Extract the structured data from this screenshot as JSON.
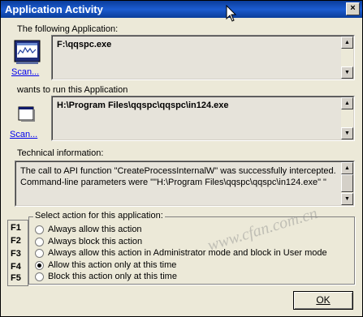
{
  "window": {
    "title": "Application Activity",
    "close_symbol": "×"
  },
  "source_app": {
    "label": "The following Application:",
    "scan_label": "Scan...",
    "path": "F:\\qqspc.exe"
  },
  "target_app": {
    "label": "wants to run this Application",
    "scan_label": "Scan...",
    "path": "H:\\Program Files\\qqspc\\qqspc\\in124.exe"
  },
  "technical": {
    "label": "Technical information:",
    "line1": "The call to API function \"CreateProcessInternalW\" was successfully intercepted.",
    "line2": "Command-line parameters were \"\"H:\\Program Files\\qqspc\\qqspc\\in124.exe\" \""
  },
  "actions": {
    "group_label": "Select action for this application:",
    "fkeys": [
      "F1",
      "F2",
      "F3",
      "F4",
      "F5"
    ],
    "options": [
      "Always allow this action",
      "Always block this action",
      "Always allow this action in Administrator mode and block in User mode",
      "Allow this action only at this time",
      "Block this action only at this time"
    ],
    "selected_index": 3
  },
  "ok_button": {
    "label": "OK"
  },
  "watermark": "www.cfan.com.cn"
}
